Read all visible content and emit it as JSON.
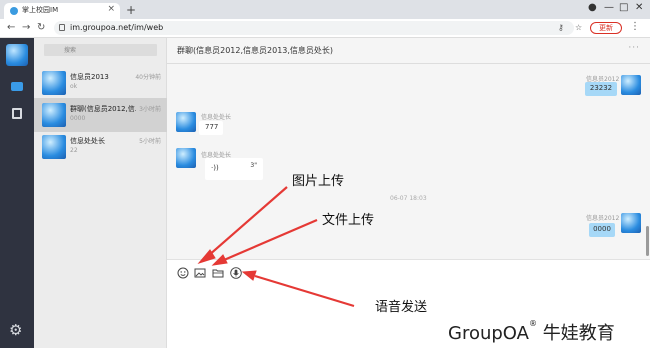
{
  "browser": {
    "tab_title": "掌上校园IM",
    "url": "im.groupoa.net/im/web",
    "update_label": "更新"
  },
  "sidebar": {
    "search_placeholder": "搜索",
    "conversations": [
      {
        "name": "信息员2013",
        "time": "40分钟前",
        "preview": "ok"
      },
      {
        "name": "群聊(信息员2012,信...",
        "time": "3小时前",
        "preview": "0000"
      },
      {
        "name": "信息处处长",
        "time": "5小时前",
        "preview": "22"
      }
    ]
  },
  "chat": {
    "title": "群聊(信息员2012,信息员2013,信息员处长)",
    "more": "···",
    "messages": [
      {
        "sender": "信息员2012",
        "text": "23232",
        "direction": "out"
      },
      {
        "sender": "信息处处长",
        "text": "777",
        "direction": "in"
      },
      {
        "sender": "信息处处长",
        "voice_duration": "3\"",
        "direction": "in"
      },
      {
        "timestamp": "06-07 18:03"
      },
      {
        "sender": "信息员2012",
        "text": "0000",
        "direction": "out"
      }
    ]
  },
  "composer_icons": [
    "emoji-icon",
    "image-upload-icon",
    "file-upload-icon",
    "voice-icon"
  ],
  "annotations": {
    "image_upload": "图片上传",
    "file_upload": "文件上传",
    "voice_send": "语音发送"
  },
  "watermark": {
    "brand": "GroupOA",
    "reg": "®",
    "suffix": " 牛娃教育"
  },
  "colors": {
    "rail_bg": "#2f3340",
    "accent_blue": "#3a9be8",
    "bubble_out": "#a6d8f7",
    "arrow_red": "#e53935",
    "update_red": "#d93025"
  }
}
